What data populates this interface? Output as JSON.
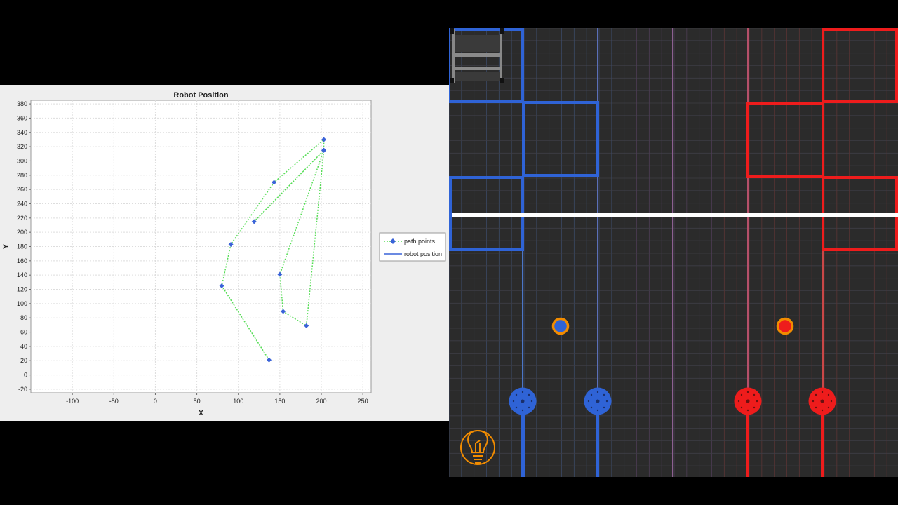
{
  "chart_data": {
    "type": "scatter",
    "title": "Robot Position",
    "xlabel": "X",
    "ylabel": "Y",
    "xlim": [
      -150,
      260
    ],
    "ylim": [
      -25,
      385
    ],
    "xticks": [
      -100,
      -50,
      0,
      50,
      100,
      150,
      200,
      250
    ],
    "yticks": [
      -20,
      0,
      20,
      40,
      60,
      80,
      100,
      120,
      140,
      160,
      180,
      200,
      220,
      240,
      260,
      280,
      300,
      320,
      340,
      360,
      380
    ],
    "grid": true,
    "legend_position": "right",
    "series": [
      {
        "name": "path points",
        "style": "dotted line with diamond markers",
        "line_color": "#55dd55",
        "marker_color": "#3a63d8",
        "points": [
          {
            "x": 137,
            "y": 21
          },
          {
            "x": 80,
            "y": 125
          },
          {
            "x": 91,
            "y": 183
          },
          {
            "x": 143,
            "y": 270
          },
          {
            "x": 203,
            "y": 330
          },
          {
            "x": 203,
            "y": 315
          },
          {
            "x": 119,
            "y": 215
          },
          {
            "x": 203,
            "y": 315
          },
          {
            "x": 182,
            "y": 69
          },
          {
            "x": 154,
            "y": 89
          },
          {
            "x": 150,
            "y": 141
          },
          {
            "x": 203,
            "y": 315
          }
        ]
      },
      {
        "name": "robot position",
        "style": "solid line",
        "line_color": "#3a63d8",
        "points": []
      }
    ]
  },
  "field": {
    "background": "#2b2b2b",
    "blue_color": "#2f63d6",
    "red_color": "#ee1c1c",
    "ring_color": "#f28c00",
    "white_line_color": "#ffffff",
    "icons": [
      "bridge-icon",
      "lightbulb-icon"
    ]
  }
}
